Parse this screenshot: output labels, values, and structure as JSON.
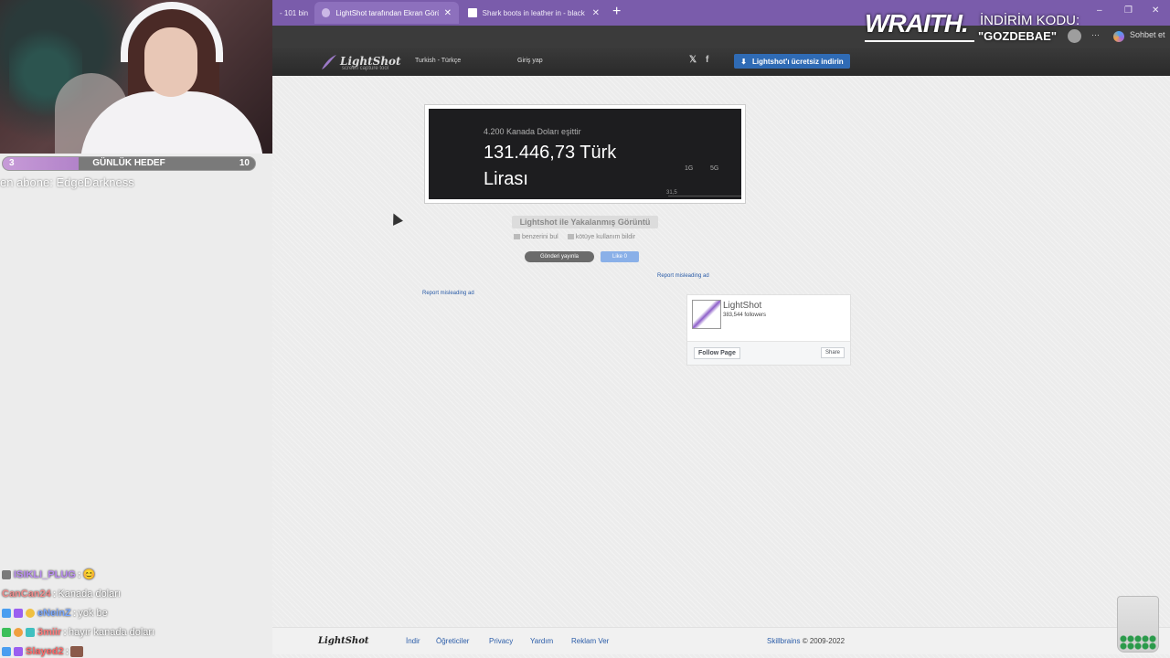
{
  "stream": {
    "goal": {
      "title": "GÜNLÜK HEDEF",
      "current": "3",
      "target": "10",
      "progress": 0.3
    },
    "new_sub": "en abone: EdgeDarkness",
    "chat": [
      {
        "user": "ISIKLI_PLUG",
        "user_color": "#b98cf0",
        "message": "😊"
      },
      {
        "user": "CanCan24",
        "user_color": "#f08a8a",
        "message": "Kanada doları"
      },
      {
        "user": "eNeinZ",
        "user_color": "#7aa8ff",
        "message": "yok be"
      },
      {
        "user": "3miir",
        "user_color": "#ff7b7b",
        "message": "hayır kanada doları"
      },
      {
        "user": "Slayed2",
        "user_color": "#ff6a6a",
        "message": ""
      }
    ],
    "sponsor": {
      "brand": "WRAITH.",
      "discount_label": "İNDİRİM KODU:",
      "code": "\"GOZDEBAE\""
    }
  },
  "browser": {
    "tabs": [
      {
        "title": "- 101 bin"
      },
      {
        "title": "LightShot tarafından Ekran Görüntü"
      },
      {
        "title": "Shark boots in leather in - black | C"
      }
    ],
    "chat_button": "Sohbet et",
    "more": "···",
    "window_controls": {
      "minimize": "–",
      "restore": "❐",
      "close": "✕"
    }
  },
  "site": {
    "header": {
      "logo": "LightShot",
      "tagline": "screen capture tool",
      "language": "Turkish - Türkçe",
      "login": "Giriş yap",
      "twitter": "𝕏",
      "facebook": "f",
      "download": "Lightshot'ı ücretsiz indirin"
    },
    "screenshot": {
      "subtitle": "4.200 Kanada Doları eşittir",
      "amount": "131.446,73 Türk Lirası",
      "ranges": [
        "1G",
        "5G"
      ],
      "tick": "31,5"
    },
    "caption": "Lightshot ile Yakalanmış Görüntü",
    "actions": {
      "similar": "benzerini bul",
      "report_abuse": "kötüye kullanım bildir"
    },
    "tweet": "Gönderi yayınla",
    "like": "Like 0",
    "report_ad": "Report misleading ad",
    "fb": {
      "name": "LightShot",
      "followers": "383,544 followers",
      "follow": "Follow Page",
      "share": "Share"
    },
    "footer": {
      "logo": "LightShot",
      "links": [
        "İndir",
        "Öğreticiler",
        "Privacy",
        "Yardım",
        "Reklam Ver"
      ],
      "brand": "Skillbrains",
      "copyright": "© 2009-2022"
    }
  },
  "colors": {
    "tabbar": "#7a5cab",
    "download_button": "#2f6bb5",
    "link": "#2a5ca8"
  }
}
